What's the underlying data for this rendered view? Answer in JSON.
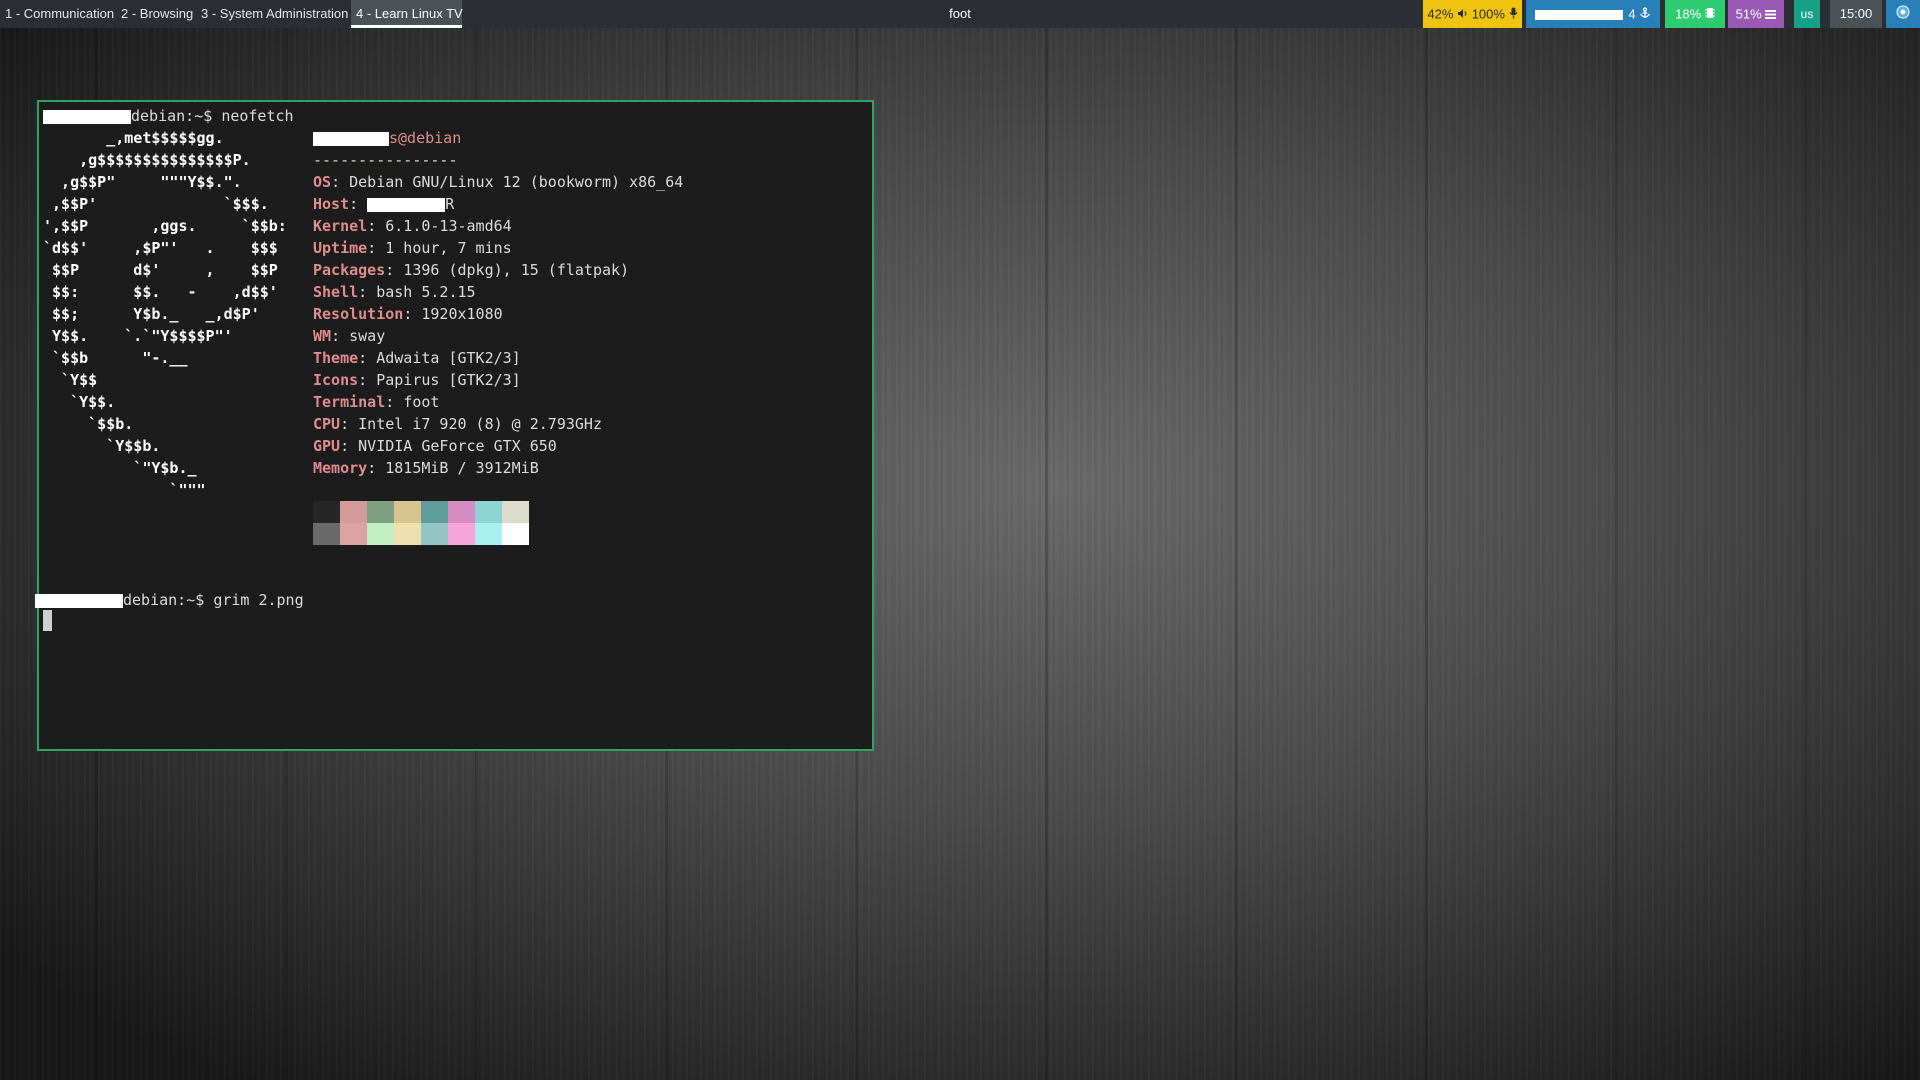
{
  "topbar": {
    "workspaces": [
      {
        "label": "1 - Communication",
        "active": false
      },
      {
        "label": "2 - Browsing",
        "active": false
      },
      {
        "label": "3 - System Administration",
        "active": false
      },
      {
        "label": "4 - Learn Linux TV",
        "active": true
      }
    ],
    "window_title": "foot",
    "audio": {
      "volume": "42%",
      "volume_icon": "speaker-icon",
      "mic": "100%",
      "mic_icon": "microphone-icon"
    },
    "network": {
      "suffix": "4",
      "icon": "network-icon"
    },
    "cpu": {
      "value": "18%",
      "icon": "cpu-icon"
    },
    "memory": {
      "value": "51%",
      "icon": "memory-icon"
    },
    "keyboard": {
      "layout": "us"
    },
    "clock": {
      "time": "15:00"
    },
    "tray": {
      "icon": "tray-app-icon"
    },
    "colors": {
      "bar_bg": "#2b2f33",
      "audio": "#f1c40f",
      "network": "#2980b9",
      "cpu": "#2ecc71",
      "memory": "#9b59b6",
      "keyboard": "#16a085",
      "clock": "#4a5157",
      "tray": "#2980b9"
    }
  },
  "terminal": {
    "border_color": "#2fa35f",
    "prompt1": {
      "host": "debian:~$ ",
      "command": "neofetch"
    },
    "ascii_art": [
      "       _,met$$$$$gg.",
      "    ,g$$$$$$$$$$$$$$$P.",
      "  ,g$$P\"     \"\"\"Y$$.\".",
      " ,$$P'              `$$$.",
      "',$$P       ,ggs.     `$$b:",
      "`d$$'     ,$P\"'   .    $$$",
      " $$P      d$'     ,    $$P",
      " $$:      $$.   -    ,d$$'",
      " $$;      Y$b._   _,d$P'",
      " Y$$.    `.`\"Y$$$$P\"'",
      " `$$b      \"-.__",
      "  `Y$$",
      "   `Y$$.",
      "     `$$b.",
      "       `Y$$b.",
      "          `\"Y$b._",
      "              `\"\"\""
    ],
    "user_host_suffix": "s@debian",
    "separator": "----------------",
    "info": [
      {
        "label": "OS",
        "value": "Debian GNU/Linux 12 (bookworm) x86_64"
      },
      {
        "label": "Host",
        "value": "R"
      },
      {
        "label": "Kernel",
        "value": "6.1.0-13-amd64"
      },
      {
        "label": "Uptime",
        "value": "1 hour, 7 mins"
      },
      {
        "label": "Packages",
        "value": "1396 (dpkg), 15 (flatpak)"
      },
      {
        "label": "Shell",
        "value": "bash 5.2.15"
      },
      {
        "label": "Resolution",
        "value": "1920x1080"
      },
      {
        "label": "WM",
        "value": "sway"
      },
      {
        "label": "Theme",
        "value": "Adwaita [GTK2/3]"
      },
      {
        "label": "Icons",
        "value": "Papirus [GTK2/3]"
      },
      {
        "label": "Terminal",
        "value": "foot"
      },
      {
        "label": "CPU",
        "value": "Intel i7 920 (8) @ 2.793GHz"
      },
      {
        "label": "GPU",
        "value": "NVIDIA GeForce GTX 650"
      },
      {
        "label": "Memory",
        "value": "1815MiB / 3912MiB"
      }
    ],
    "palette_row1": [
      "#262626",
      "#d49a9a",
      "#7f9f7f",
      "#d8c48e",
      "#5f9c9c",
      "#d58cc2",
      "#8fd3d3",
      "#dcdccc"
    ],
    "palette_row2": [
      "#6a6a6a",
      "#dca3a3",
      "#c3f0c3",
      "#f0dfaf",
      "#93c5c5",
      "#f5a4dc",
      "#a8f0f0",
      "#ffffff"
    ],
    "prompt2": {
      "host": "debian:~$ ",
      "command": "grim 2.png"
    }
  }
}
